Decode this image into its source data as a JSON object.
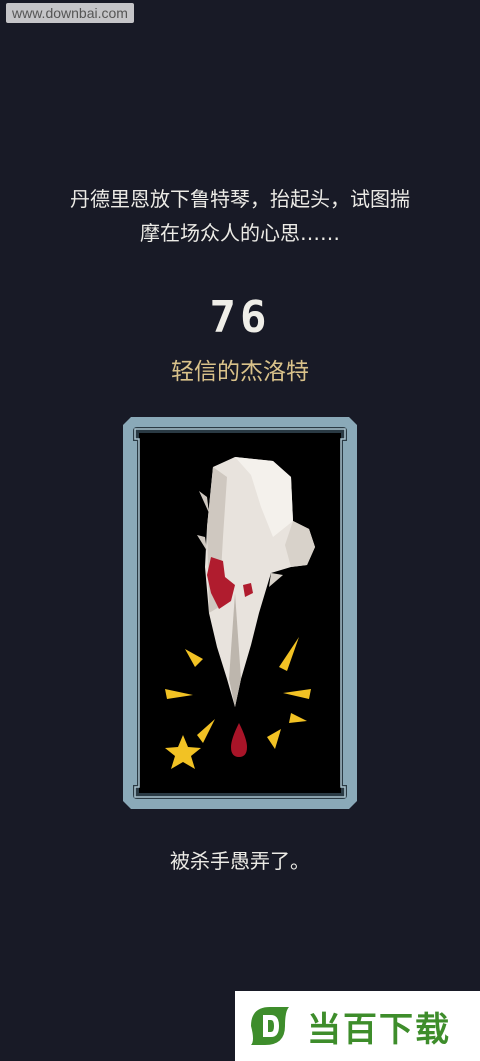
{
  "watermark": {
    "url": "www.downbai.com",
    "brand": "当百下载"
  },
  "narration": {
    "line1": "丹德里恩放下鲁特琴，抬起头，试图揣",
    "line2": "摩在场众人的心思……"
  },
  "score": "76",
  "character_name": "轻信的杰洛特",
  "card": {
    "icon": "quill-feather-icon",
    "frame_color": "#8aa9b8",
    "background_color": "#000000",
    "feather_color": "#e8e3dd",
    "blood_color": "#b01c2e",
    "burst_color": "#f2c224"
  },
  "result": "被杀手愚弄了。",
  "colors": {
    "background": "#181a26",
    "title_gold": "#d9c28a",
    "logo_green": "#3e8d2b"
  }
}
